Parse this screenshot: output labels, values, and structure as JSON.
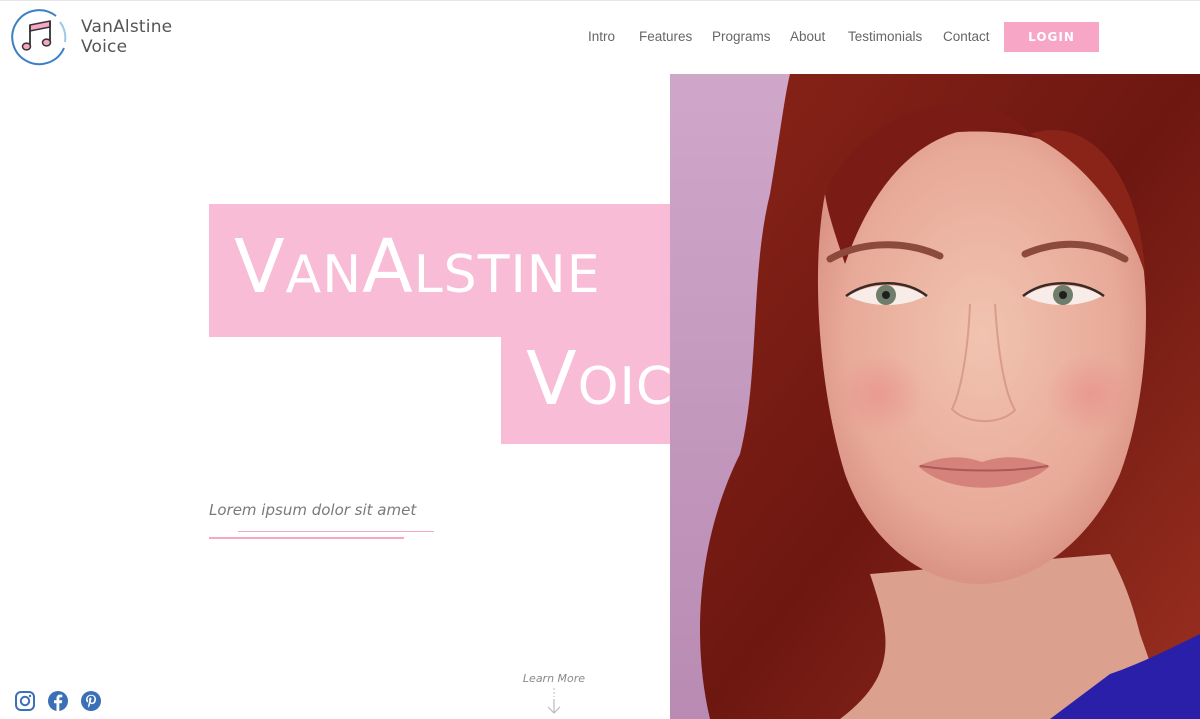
{
  "header": {
    "brand_line1": "VanAlstine",
    "brand_line2": "Voice",
    "nav": [
      {
        "label": "Intro"
      },
      {
        "label": "Features"
      },
      {
        "label": "Programs"
      },
      {
        "label": "About"
      },
      {
        "label": "Testimonials"
      },
      {
        "label": "Contact"
      }
    ],
    "login_label": "LOGIN"
  },
  "hero": {
    "title_line1": "VanAlstine",
    "title_line2": "Voice",
    "subtitle": "Lorem ipsum dolor sit amet",
    "learn_more": "Learn More"
  },
  "social": [
    "instagram-icon",
    "facebook-icon",
    "pinterest-icon"
  ],
  "colors": {
    "accent_pink": "#f7a6c6",
    "title_box_pink": "#f8bcd6",
    "icon_blue": "#3b6fb6",
    "portrait_bg": "#c9a0c4",
    "hair": "#7a1c15",
    "shirt": "#2a1fa8"
  }
}
